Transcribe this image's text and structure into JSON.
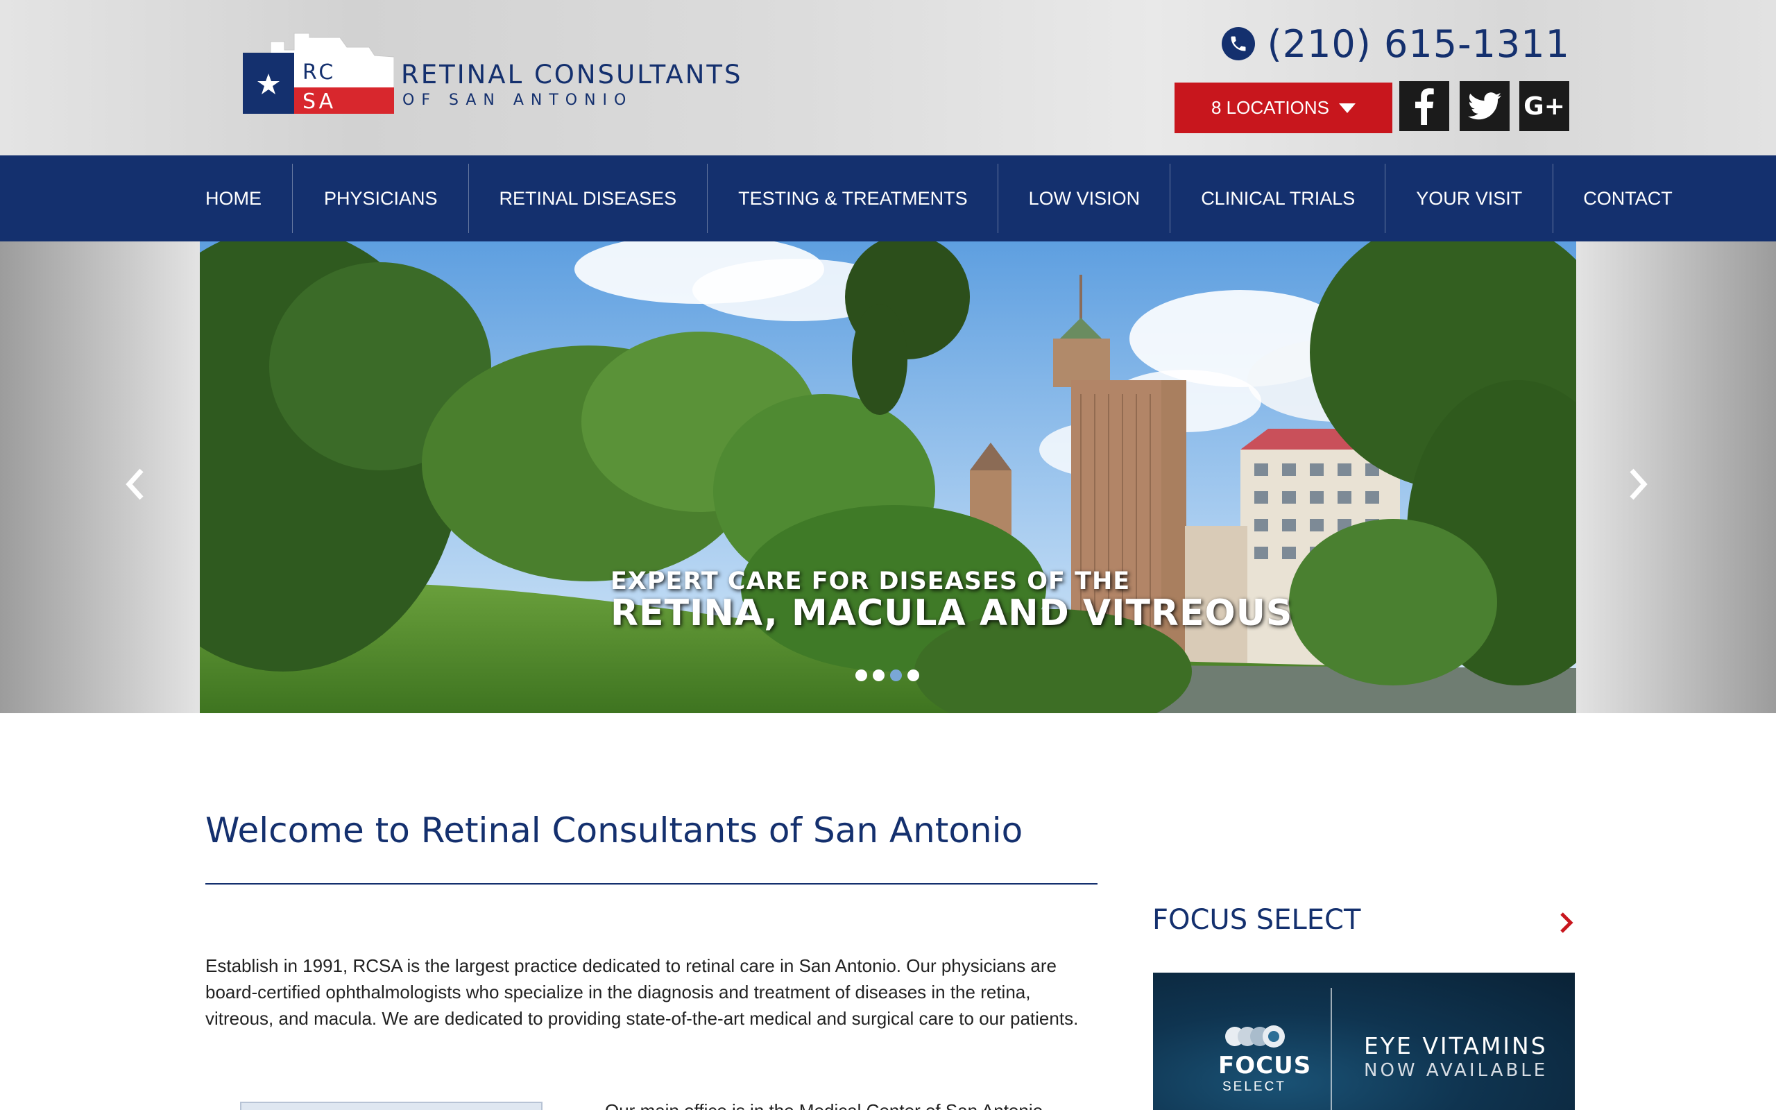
{
  "colors": {
    "navy": "#14306e",
    "red": "#c8161d",
    "social_bg": "#1b1b1b",
    "dot_active": "#7aa7d6"
  },
  "logo": {
    "initials_top": "RC",
    "initials_bottom": "SA",
    "title": "RETINAL CONSULTANTS",
    "subtitle": "OF SAN ANTONIO"
  },
  "header": {
    "phone": "(210) 615-1311",
    "phone_icon": "phone-icon",
    "locations_label": "8 LOCATIONS",
    "social": [
      {
        "name": "facebook",
        "glyph": "f"
      },
      {
        "name": "twitter",
        "glyph": "twitter-bird"
      },
      {
        "name": "google-plus",
        "glyph": "G+"
      }
    ]
  },
  "nav": {
    "items": [
      {
        "label": "HOME"
      },
      {
        "label": "PHYSICIANS"
      },
      {
        "label": "RETINAL DISEASES"
      },
      {
        "label": "TESTING & TREATMENTS"
      },
      {
        "label": "LOW VISION"
      },
      {
        "label": "CLINICAL TRIALS"
      },
      {
        "label": "YOUR VISIT"
      },
      {
        "label": "CONTACT"
      }
    ]
  },
  "hero": {
    "line1": "EXPERT CARE FOR DISEASES OF THE",
    "line2": "RETINA, MACULA AND VITREOUS",
    "slide_count": 4,
    "active_slide": 3
  },
  "main": {
    "title": "Welcome to Retinal Consultants of San Antonio",
    "intro": "Establish in 1991, RCSA is the largest practice dedicated to retinal care in San Antonio. Our physicians are board-certified ophthalmologists who specialize in the diagnosis and treatment of diseases in the retina, vitreous, and macula. We are dedicated to providing state-of-the-art medical and surgical care to our patients.",
    "next_paragraph_start": "Our main office is in the Medical Center of San Antonio"
  },
  "sidebar": {
    "title": "FOCUS SELECT",
    "promo": {
      "brand": "FOCUS",
      "brand_sub": "SELECT",
      "headline": "EYE VITAMINS",
      "subline": "NOW AVAILABLE"
    }
  }
}
